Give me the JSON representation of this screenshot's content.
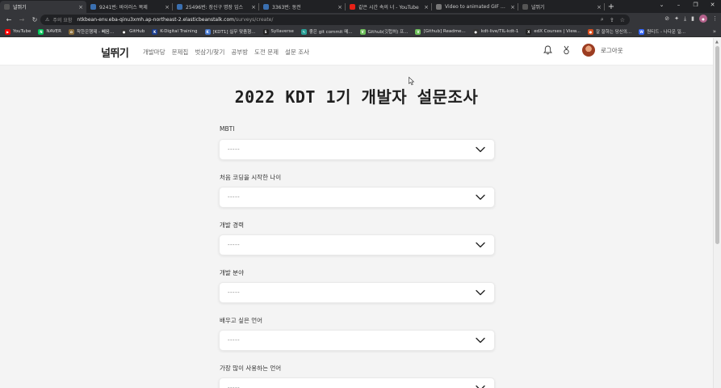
{
  "browser": {
    "tabs": [
      {
        "title": "널뛰기",
        "active": true,
        "fav_color": "#555555"
      },
      {
        "title": "9241번: 바이러스 복제",
        "fav_color": "#3a6fb0"
      },
      {
        "title": "25496번: 장신구 명장 임스",
        "fav_color": "#3a6fb0"
      },
      {
        "title": "3363번: 동전",
        "fav_color": "#3a6fb0"
      },
      {
        "title": "같은 시간 속의 너 - YouTube",
        "fav_color": "#e62117"
      },
      {
        "title": "Video to animated GIF converter",
        "fav_color": "#777777"
      },
      {
        "title": "널뛰기",
        "fav_color": "#555555"
      }
    ],
    "tab_close": "×",
    "new_tab": "+",
    "window_controls": [
      "⌄",
      "–",
      "❐",
      "✕"
    ],
    "address": {
      "security_label": "주의 요함",
      "host": "ntkbean-env.eba-qinu3xmh.ap-northeast-2.elasticbeanstalk.com",
      "path": "/surveys/create/"
    },
    "bookmarks": [
      {
        "label": "YouTube",
        "color": "#ff0000",
        "glyph": "▶"
      },
      {
        "label": "NAVER",
        "color": "#03c75a",
        "glyph": "N"
      },
      {
        "label": "착한은행제 - 빼음...",
        "color": "#8a6d3b",
        "glyph": "✿"
      },
      {
        "label": "GitHub",
        "color": "#333333",
        "glyph": "●"
      },
      {
        "label": "K-Digital Training",
        "color": "#1d3f8f",
        "glyph": "K"
      },
      {
        "label": "[KDT1] 실무 맞춤형...",
        "color": "#4a7bd0",
        "glyph": "K"
      },
      {
        "label": "Syllaverse",
        "color": "#222222",
        "glyph": "S"
      },
      {
        "label": "좋은 git commit 메...",
        "color": "#2aa198",
        "glyph": "✎"
      },
      {
        "label": "Github(깃헙허) 프...",
        "color": "#6dbf5a",
        "glyph": "V"
      },
      {
        "label": "[Github] Readme...",
        "color": "#6dbf5a",
        "glyph": "V"
      },
      {
        "label": "kdt-live/TIL-kdt-1",
        "color": "#333333",
        "glyph": "●"
      },
      {
        "label": "edX Courses | View...",
        "color": "#222222",
        "glyph": "X"
      },
      {
        "label": "잘 잘하는 당신의...",
        "color": "#d94f1e",
        "glyph": "●"
      },
      {
        "label": "원티드 - 나다운 일...",
        "color": "#3366ff",
        "glyph": "W"
      }
    ],
    "bookmarks_more": "»"
  },
  "site": {
    "logo": "널뛰기",
    "nav": [
      "개발마당",
      "문제집",
      "벗삼기/찾기",
      "공부방",
      "도전 문제",
      "설문 조사"
    ],
    "logout": "로그아웃"
  },
  "survey": {
    "title": "2022 KDT 1기 개발자 설문조사",
    "questions": [
      {
        "label": "MBTI",
        "value": "-----"
      },
      {
        "label": "처음 코딩을 시작한 나이",
        "value": "-----"
      },
      {
        "label": "개발 경력",
        "value": "-----"
      },
      {
        "label": "개발 분야",
        "value": "-----"
      },
      {
        "label": "배우고 싶은 언어",
        "value": "-----"
      },
      {
        "label": "가장 많이 사용하는 언어",
        "value": "-----"
      }
    ]
  }
}
